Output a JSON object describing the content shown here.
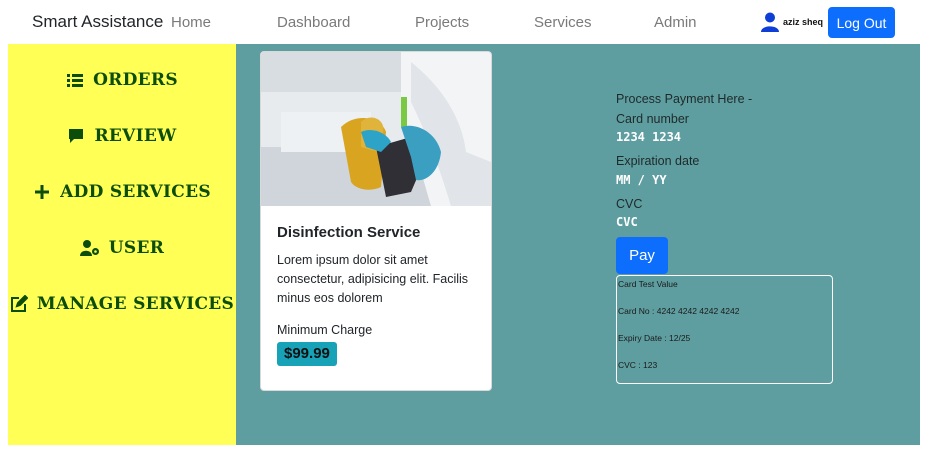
{
  "navbar": {
    "brand": "Smart Assistance",
    "links": [
      "Home",
      "Dashboard",
      "Projects",
      "Services",
      "Admin"
    ],
    "user_icon": "user-icon",
    "user_name": "aziz sheq",
    "logout_label": "Log Out",
    "accent_color": "#0d6efd"
  },
  "sidebar": {
    "background": "#ffff55",
    "items": [
      {
        "label": "ORDERS",
        "icon": "list-icon"
      },
      {
        "label": "REVIEW",
        "icon": "comment-icon"
      },
      {
        "label": "ADD SERVICES",
        "icon": "plus-icon"
      },
      {
        "label": "USER",
        "icon": "user-cog-icon"
      },
      {
        "label": "MANAGE SERVICES",
        "icon": "edit-icon"
      }
    ]
  },
  "main": {
    "background": "#5f9ea0",
    "card": {
      "image": "cleaning-photo",
      "title": "Disinfection Service",
      "text": "Lorem ipsum dolor sit amet consectetur, adipisicing elit. Facilis minus eos dolorem",
      "charge_label": "Minimum Charge",
      "price": "$99.99"
    },
    "payment": {
      "title": "Process Payment Here -",
      "card_label": "Card number",
      "card_placeholder": "1234 1234",
      "expiry_label": "Expiration date",
      "expiry_placeholder": "MM / YY",
      "cvc_label": "CVC",
      "cvc_placeholder": "CVC",
      "pay_label": "Pay",
      "test": {
        "title": "Card Test Value",
        "card_no": "Card No : 4242 4242 4242 4242",
        "expiry": "Expiry Date : 12/25",
        "cvc": "CVC : 123"
      }
    }
  }
}
